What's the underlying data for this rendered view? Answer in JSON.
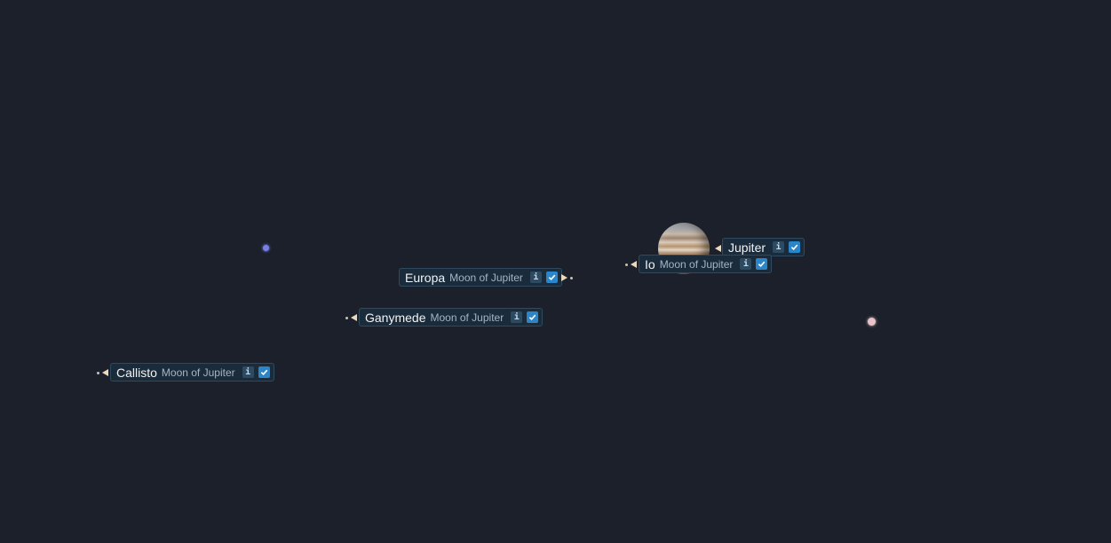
{
  "moons": [
    {
      "name": "Io",
      "subtitle": "Moon of Jupiter",
      "info": "i"
    },
    {
      "name": "Europa",
      "subtitle": "Moon of Jupiter",
      "info": "i"
    },
    {
      "name": "Ganymede",
      "subtitle": "Moon of Jupiter",
      "info": "i"
    },
    {
      "name": "Callisto",
      "subtitle": "Moon of Jupiter",
      "info": "i"
    }
  ],
  "planet": {
    "name": "Jupiter",
    "info": "i"
  },
  "colors": {
    "background": "#1c202a",
    "label_background": "#1a2c3c",
    "label_border": "#2f4a5e",
    "checkbox": "#2a86c9",
    "star_blue": "#7a7fe6",
    "star_pink": "#e7c2c8",
    "pointer": "#ead9bd"
  }
}
